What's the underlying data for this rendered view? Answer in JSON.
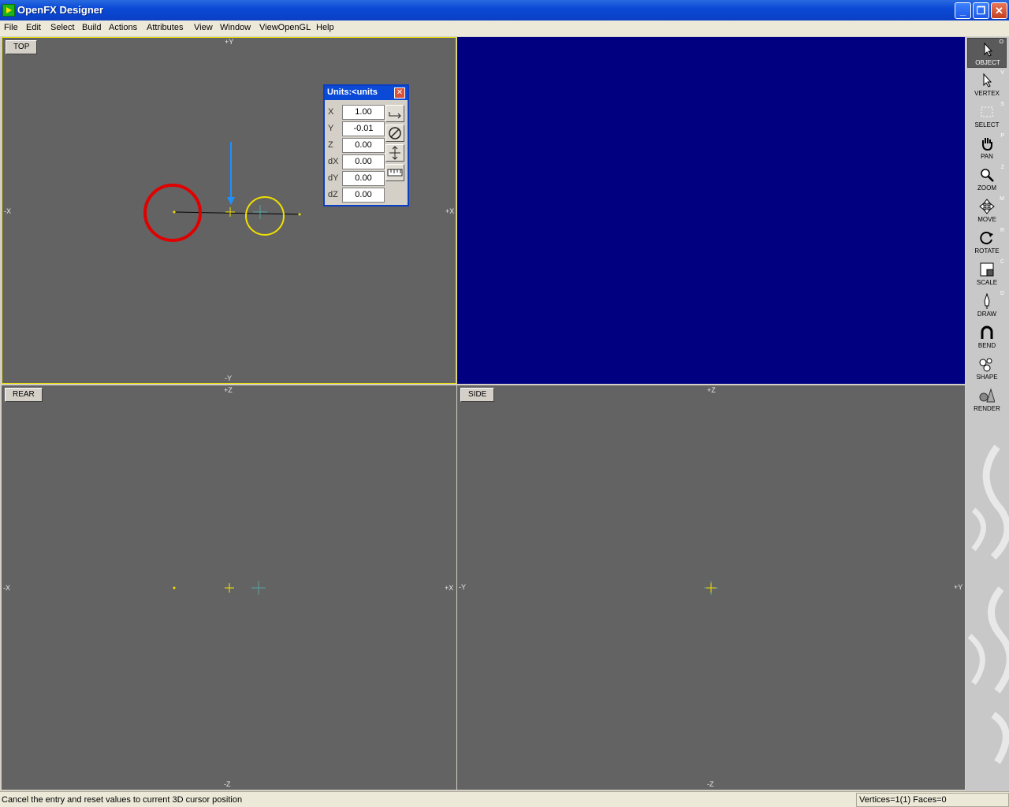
{
  "window": {
    "title": "OpenFX Designer"
  },
  "menu": [
    "File",
    "Edit",
    "Select",
    "Build",
    "Actions",
    "Attributes",
    "View",
    "Window",
    "ViewOpenGL",
    "Help"
  ],
  "viewports": {
    "top": {
      "label": "TOP",
      "axis_top": "+Y",
      "axis_bottom": "-Y",
      "axis_left": "-X",
      "axis_right": "+X"
    },
    "rear": {
      "label": "REAR",
      "axis_top": "+Z",
      "axis_bottom": "-Z",
      "axis_left": "-X",
      "axis_right": "+X"
    },
    "side": {
      "label": "SIDE",
      "axis_top": "+Z",
      "axis_bottom": "-Z",
      "axis_left": "-Y",
      "axis_right": "+Y"
    }
  },
  "units_dialog": {
    "title": "Units:<units",
    "fields": [
      {
        "label": "X",
        "value": "1.00"
      },
      {
        "label": "Y",
        "value": "-0.01"
      },
      {
        "label": "Z",
        "value": "0.00"
      },
      {
        "label": "dX",
        "value": "0.00"
      },
      {
        "label": "dY",
        "value": "0.00"
      },
      {
        "label": "dZ",
        "value": "0.00"
      }
    ]
  },
  "tools": [
    {
      "label": "OBJECT",
      "hotkey": "O",
      "icon": "pointer-icon"
    },
    {
      "label": "VERTEX",
      "hotkey": "V",
      "icon": "vertex-pointer-icon"
    },
    {
      "label": "SELECT",
      "hotkey": "S",
      "icon": "marquee-icon"
    },
    {
      "label": "PAN",
      "hotkey": "P",
      "icon": "hand-icon"
    },
    {
      "label": "ZOOM",
      "hotkey": "Z",
      "icon": "magnifier-icon"
    },
    {
      "label": "MOVE",
      "hotkey": "M",
      "icon": "move-arrows-icon"
    },
    {
      "label": "ROTATE",
      "hotkey": "R",
      "icon": "rotate-icon"
    },
    {
      "label": "SCALE",
      "hotkey": "C",
      "icon": "scale-icon"
    },
    {
      "label": "DRAW",
      "hotkey": "D",
      "icon": "pen-icon"
    },
    {
      "label": "BEND",
      "hotkey": "",
      "icon": "magnet-icon"
    },
    {
      "label": "SHAPE",
      "hotkey": "",
      "icon": "shapes-icon"
    },
    {
      "label": "RENDER",
      "hotkey": "",
      "icon": "render-icon"
    }
  ],
  "status": {
    "message": "Cancel the entry and reset values to current 3D cursor position",
    "counts": "Vertices=1(1) Faces=0"
  },
  "colors": {
    "viewport_bg": "#636363",
    "perspective_bg": "#000080",
    "active_border": "#e8e000",
    "annotation_red": "#e00000",
    "annotation_yellow": "#f0e000",
    "annotation_blue": "#1e90ff"
  }
}
